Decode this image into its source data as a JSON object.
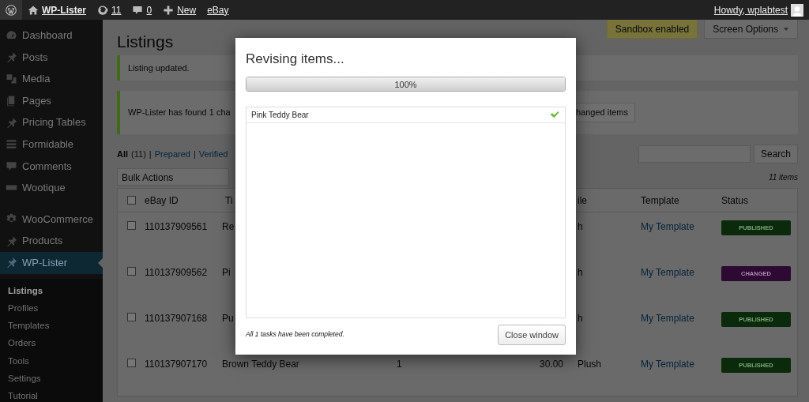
{
  "admin_bar": {
    "site": "WP-Lister",
    "updates": "11",
    "comments": "0",
    "new": "New",
    "ebay": "eBay",
    "greeting": "Howdy, wplabtest"
  },
  "sidebar": {
    "groups": [
      {
        "items": [
          {
            "label": "Dashboard",
            "kind": "gauge",
            "selected": false
          },
          {
            "label": "Posts",
            "kind": "pin",
            "selected": false
          },
          {
            "label": "Media",
            "kind": "media",
            "selected": false
          },
          {
            "label": "Pages",
            "kind": "pages",
            "selected": false
          },
          {
            "label": "Pricing Tables",
            "kind": "pin",
            "selected": false
          },
          {
            "label": "Formidable",
            "kind": "lines",
            "selected": false
          },
          {
            "label": "Comments",
            "kind": "bubble",
            "selected": false
          },
          {
            "label": "Wootique",
            "kind": "bar",
            "selected": false
          }
        ]
      },
      {
        "items": [
          {
            "label": "WooCommerce",
            "kind": "gear",
            "selected": false
          },
          {
            "label": "Products",
            "kind": "pin",
            "selected": false
          },
          {
            "label": "WP-Lister",
            "kind": "pin",
            "selected": true
          }
        ]
      }
    ],
    "submenu": [
      {
        "label": "Listings",
        "selected": true
      },
      {
        "label": "Profiles",
        "selected": false
      },
      {
        "label": "Templates",
        "selected": false
      },
      {
        "label": "Orders",
        "selected": false
      },
      {
        "label": "Tools",
        "selected": false
      },
      {
        "label": "Settings",
        "selected": false
      },
      {
        "label": "Tutorial",
        "selected": false
      }
    ]
  },
  "page": {
    "title": "Listings",
    "sandbox": "Sandbox enabled",
    "screen_options": "Screen Options",
    "notices": [
      {
        "text": "Listing updated."
      },
      {
        "text": "WP-Lister has found 1 cha",
        "button": "hanged items"
      }
    ],
    "filters": [
      {
        "label": "All",
        "count": "(11)",
        "selected": true,
        "separator": "|"
      },
      {
        "label": "Prepared",
        "selected": false,
        "separator": "|"
      },
      {
        "label": "Verified",
        "selected": false
      }
    ],
    "bulk_actions": "Bulk Actions",
    "search_button": "Search",
    "item_count": "11 items"
  },
  "table": {
    "all_checked": false,
    "columns": [
      "eBay ID",
      "Ti",
      "ile",
      "Template",
      "Status"
    ],
    "rows": [
      {
        "checked": false,
        "ebay_id": "110137909561",
        "title": "Re",
        "profile": "h",
        "template": "My Template",
        "status": {
          "label": "PUBLISHED",
          "kind": "published"
        }
      },
      {
        "checked": false,
        "ebay_id": "110137909562",
        "title": "Pi",
        "profile": "h",
        "template": "My Template",
        "status": {
          "label": "CHANGED",
          "kind": "changed"
        }
      },
      {
        "checked": false,
        "ebay_id": "110137907168",
        "title": "Pu",
        "profile": "h",
        "template": "My Template",
        "status": {
          "label": "PUBLISHED",
          "kind": "published"
        }
      },
      {
        "checked": false,
        "ebay_id": "110137907170",
        "title": "Brown Teddy Bear",
        "quantity": "1",
        "price": "30.00",
        "profile": "Plush",
        "template": "My Template",
        "status": {
          "label": "PUBLISHED",
          "kind": "published"
        }
      }
    ]
  },
  "dialog": {
    "title": "Revising items...",
    "progress": {
      "level": 1,
      "reading": "100%"
    },
    "tasks": [
      {
        "label": "Pink Teddy Bear",
        "done": true
      }
    ],
    "footer": "All 1 tasks have been completed.",
    "close_button": "Close window"
  }
}
